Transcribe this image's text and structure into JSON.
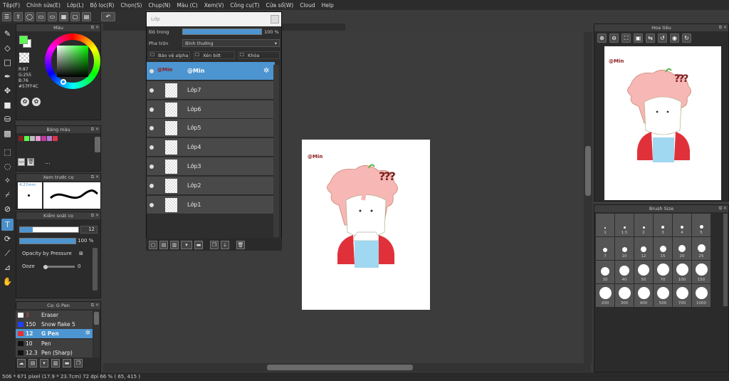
{
  "menu": [
    "Tệp(F)",
    "Chỉnh sửa(E)",
    "Lớp(L)",
    "Bộ lọc(R)",
    "Chọn(S)",
    "Chụp(N)",
    "Màu (C)",
    "Xem(V)",
    "Công cụ(T)",
    "Cửa sổ(W)",
    "Cloud",
    "Help"
  ],
  "color_panel": {
    "title": "Màu",
    "r": "R:87",
    "g": "G:255",
    "b": "B:76",
    "hex": "#57FF4C",
    "fg": "#57ff4c",
    "bg": "#ffffff"
  },
  "palette_panel": {
    "title": "Bảng màu",
    "colors": [
      "#8b2020",
      "#57ff4c",
      "#bdbdbd",
      "#e79bd6",
      "#c03a9a",
      "#b079d1",
      "#e0344b"
    ],
    "ellipsis": "..."
  },
  "brush_preview": {
    "title": "Xem trước cọ",
    "size": "4.27mm"
  },
  "brush_control": {
    "title": "Kiểm soát cọ",
    "size": "12",
    "opacity": "100 %",
    "pressure": "Opacity by Pressure",
    "ooze_label": "Ooze",
    "ooze_value": "0"
  },
  "brush_list": {
    "title": "Cọ: G Pen",
    "items": [
      {
        "size": "3",
        "name": "Eraser",
        "color": "#ffffff"
      },
      {
        "size": "150",
        "name": "Snow flake 5",
        "color": "#2040ff"
      },
      {
        "size": "12",
        "name": "G Pen",
        "color": "#e83030"
      },
      {
        "size": "10",
        "name": "Pen",
        "color": "#111111"
      },
      {
        "size": "12.3",
        "name": "Pen (Sharp)",
        "color": "#111111"
      }
    ]
  },
  "layer_window": {
    "title": "Lớp",
    "opacity_label": "Độ trong",
    "opacity_value": "100 %",
    "blend_label": "Pha trộn",
    "blend_value": "Bình thường",
    "protect_alpha": "Bảo vệ alpha",
    "clipping": "Xén bớt",
    "lock": "Khóa",
    "layers": [
      {
        "name": "@Min",
        "thumb": "@Min"
      },
      {
        "name": "Lớp7",
        "thumb": ""
      },
      {
        "name": "Lớp6",
        "thumb": ""
      },
      {
        "name": "Lớp5",
        "thumb": ""
      },
      {
        "name": "Lớp4",
        "thumb": ""
      },
      {
        "name": "Lớp3",
        "thumb": ""
      },
      {
        "name": "Lớp2",
        "thumb": ""
      },
      {
        "name": "Lớp1",
        "thumb": ""
      }
    ]
  },
  "navigator": {
    "title": "Hoa tiêu"
  },
  "brush_size": {
    "title": "Brush Size",
    "sizes": [
      "1",
      "1.5",
      "2",
      "3",
      "4",
      "5",
      "7",
      "10",
      "12",
      "15",
      "20",
      "25",
      "30",
      "40",
      "50",
      "70",
      "100",
      "150",
      "200",
      "300",
      "400",
      "500",
      "700",
      "1000"
    ]
  },
  "canvas": {
    "watermark": "@Min",
    "question": "???"
  },
  "status": "506 * 671 pixel   (17.9 * 23.7cm)   72 dpi   66 %   ( 65, 415 )"
}
